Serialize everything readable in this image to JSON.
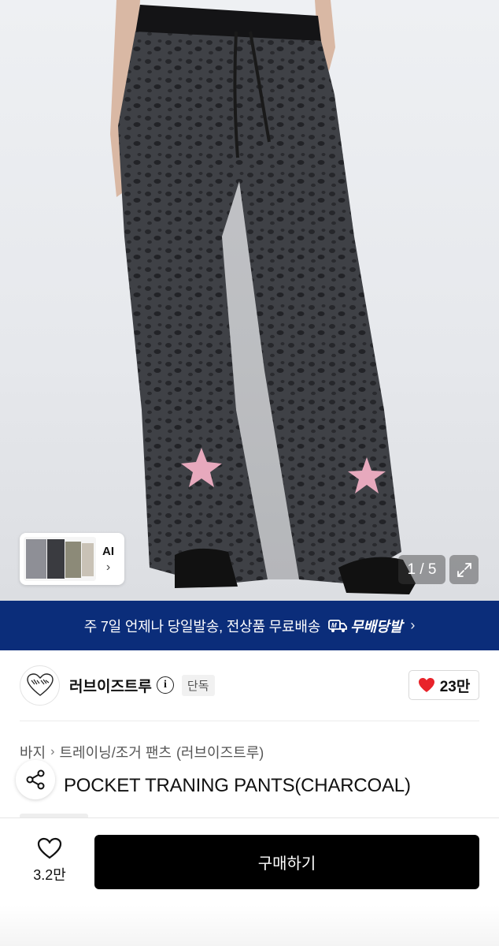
{
  "gallery": {
    "ai_label": "AI",
    "counter": "1 / 5",
    "ai_chevron": "›"
  },
  "promo": {
    "text": "주 7일 언제나 당일발송, 전상품 무료배송",
    "badge_label": "무배당발",
    "chevron": "›",
    "color": "#0b2d7a"
  },
  "brand": {
    "name": "러브이즈트루",
    "info_glyph": "i",
    "exclusive_label": "단독",
    "like_count": "23만",
    "heart_color": "#e8232a"
  },
  "breadcrumb": {
    "items": [
      "바지",
      "트레이닝/조거 팬츠",
      "(러브이즈트루)"
    ],
    "separator": "›"
  },
  "product": {
    "title": "POCKET TRANING PANTS(CHARCOAL)"
  },
  "bottom_bar": {
    "wishlist_count": "3.2만",
    "buy_label": "구매하기"
  },
  "icons": {
    "info": "info-icon",
    "heart": "heart-icon",
    "share": "share-icon",
    "expand": "expand-icon",
    "chevron": "chevron-right-icon"
  }
}
